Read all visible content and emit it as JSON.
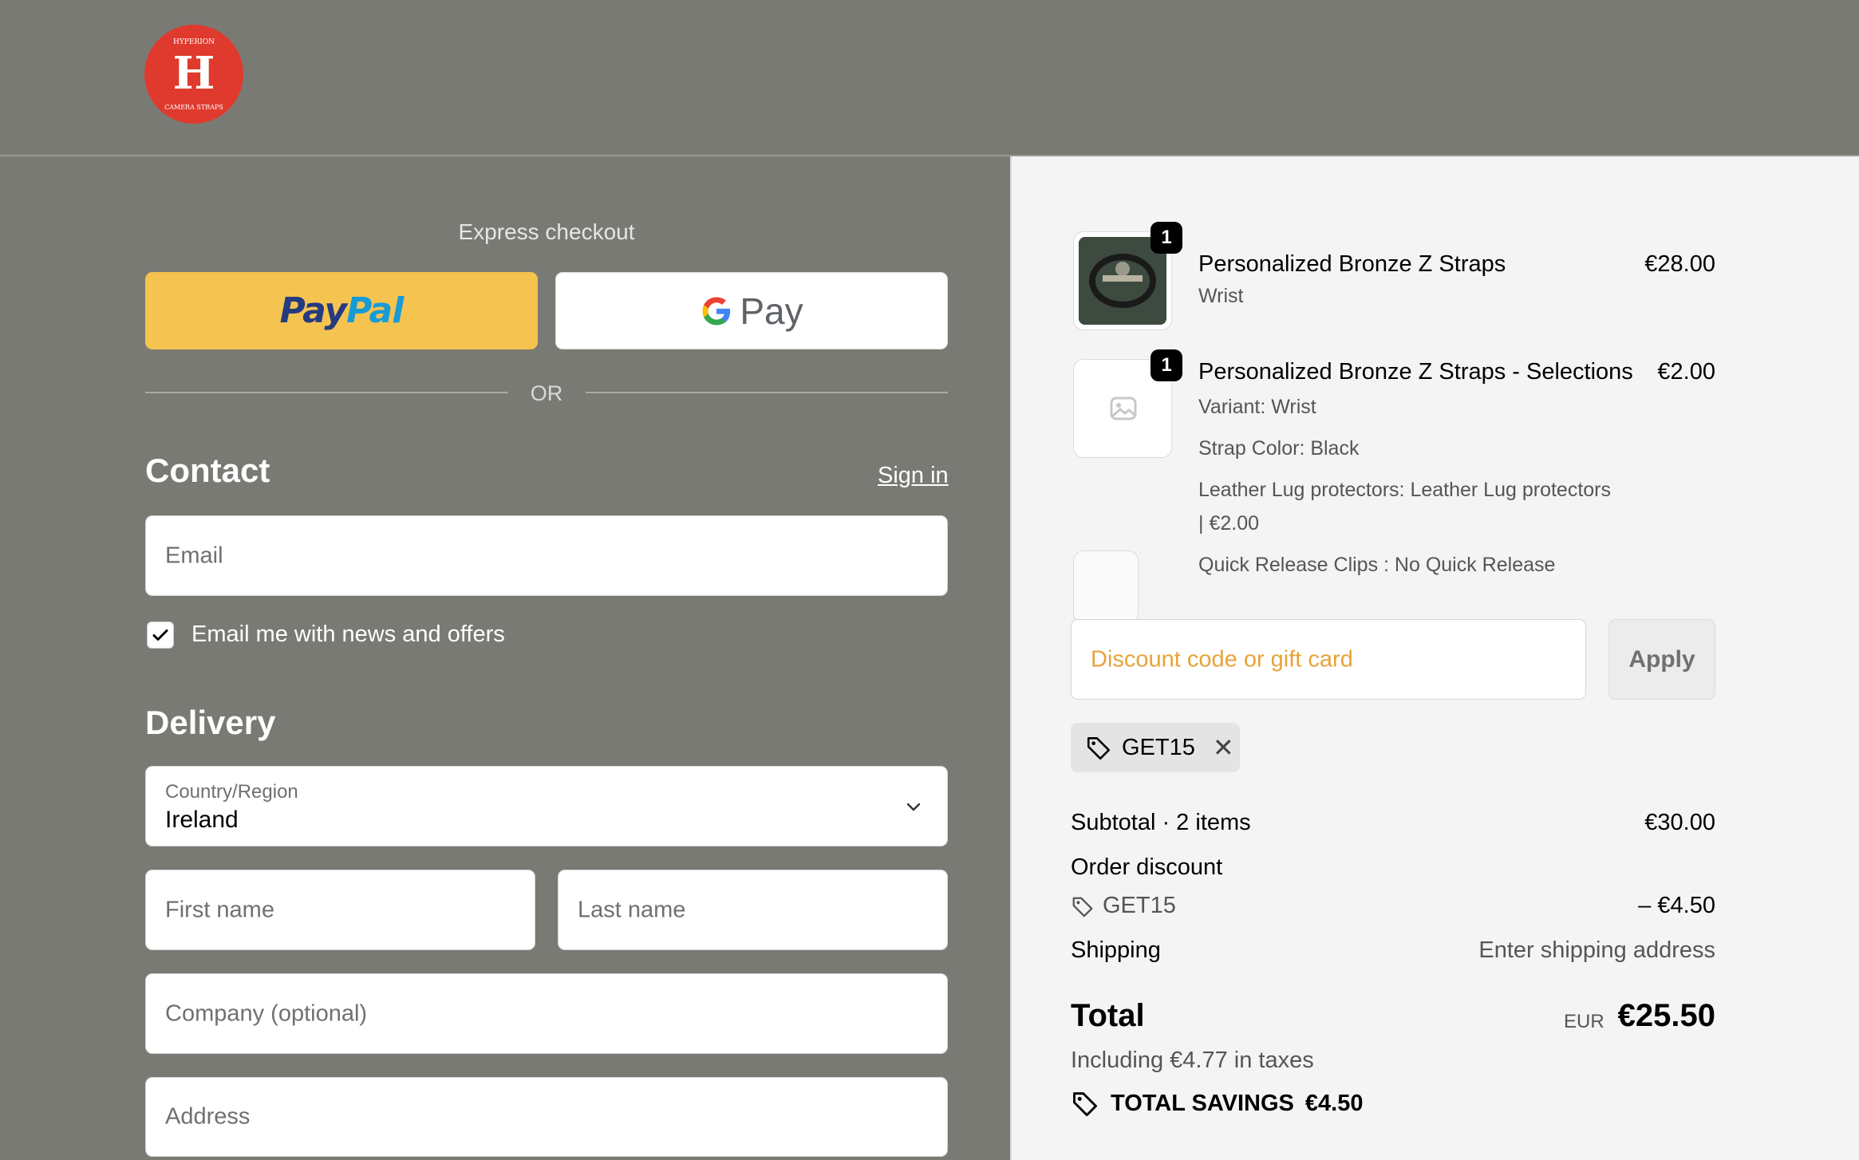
{
  "header": {
    "logo_lines": [
      "HYPERION",
      "H",
      "CAMERA STRAPS"
    ],
    "brand_color": "#e03a2e"
  },
  "checkout": {
    "express_title": "Express checkout",
    "paypal": {
      "pay": "Pay",
      "pal": "Pal"
    },
    "gpay_label": "Pay",
    "or_label": "OR",
    "contact": {
      "title": "Contact",
      "signin_label": "Sign in",
      "email_placeholder": "Email",
      "newsletter_label": "Email me with news and offers",
      "newsletter_checked": true
    },
    "delivery": {
      "title": "Delivery",
      "country_label": "Country/Region",
      "country_value": "Ireland",
      "first_name_placeholder": "First name",
      "last_name_placeholder": "Last name",
      "company_placeholder": "Company (optional)",
      "address_placeholder": "Address"
    }
  },
  "summary": {
    "items": [
      {
        "qty": "1",
        "name": "Personalized Bronze Z Straps",
        "sub": "Wrist",
        "price": "€28.00"
      },
      {
        "qty": "1",
        "name": "Personalized Bronze Z Straps - Selections",
        "price": "€2.00",
        "options": [
          "Variant: Wrist",
          "Strap Color: Black",
          "Leather Lug protectors: Leather Lug protectors",
          "| €2.00",
          "Quick Release Clips : No Quick Release"
        ]
      }
    ],
    "discount_placeholder": "Discount code or gift card",
    "apply_label": "Apply",
    "applied_code": "GET15",
    "subtotal_label": "Subtotal · 2 items",
    "subtotal_value": "€30.00",
    "order_discount_label": "Order discount",
    "discount_code": "GET15",
    "discount_value": "– €4.50",
    "shipping_label": "Shipping",
    "shipping_value": "Enter shipping address",
    "total_label": "Total",
    "currency": "EUR",
    "total_value": "€25.50",
    "taxes_label": "Including €4.77 in taxes",
    "savings_label": "TOTAL SAVINGS",
    "savings_value": "€4.50"
  }
}
